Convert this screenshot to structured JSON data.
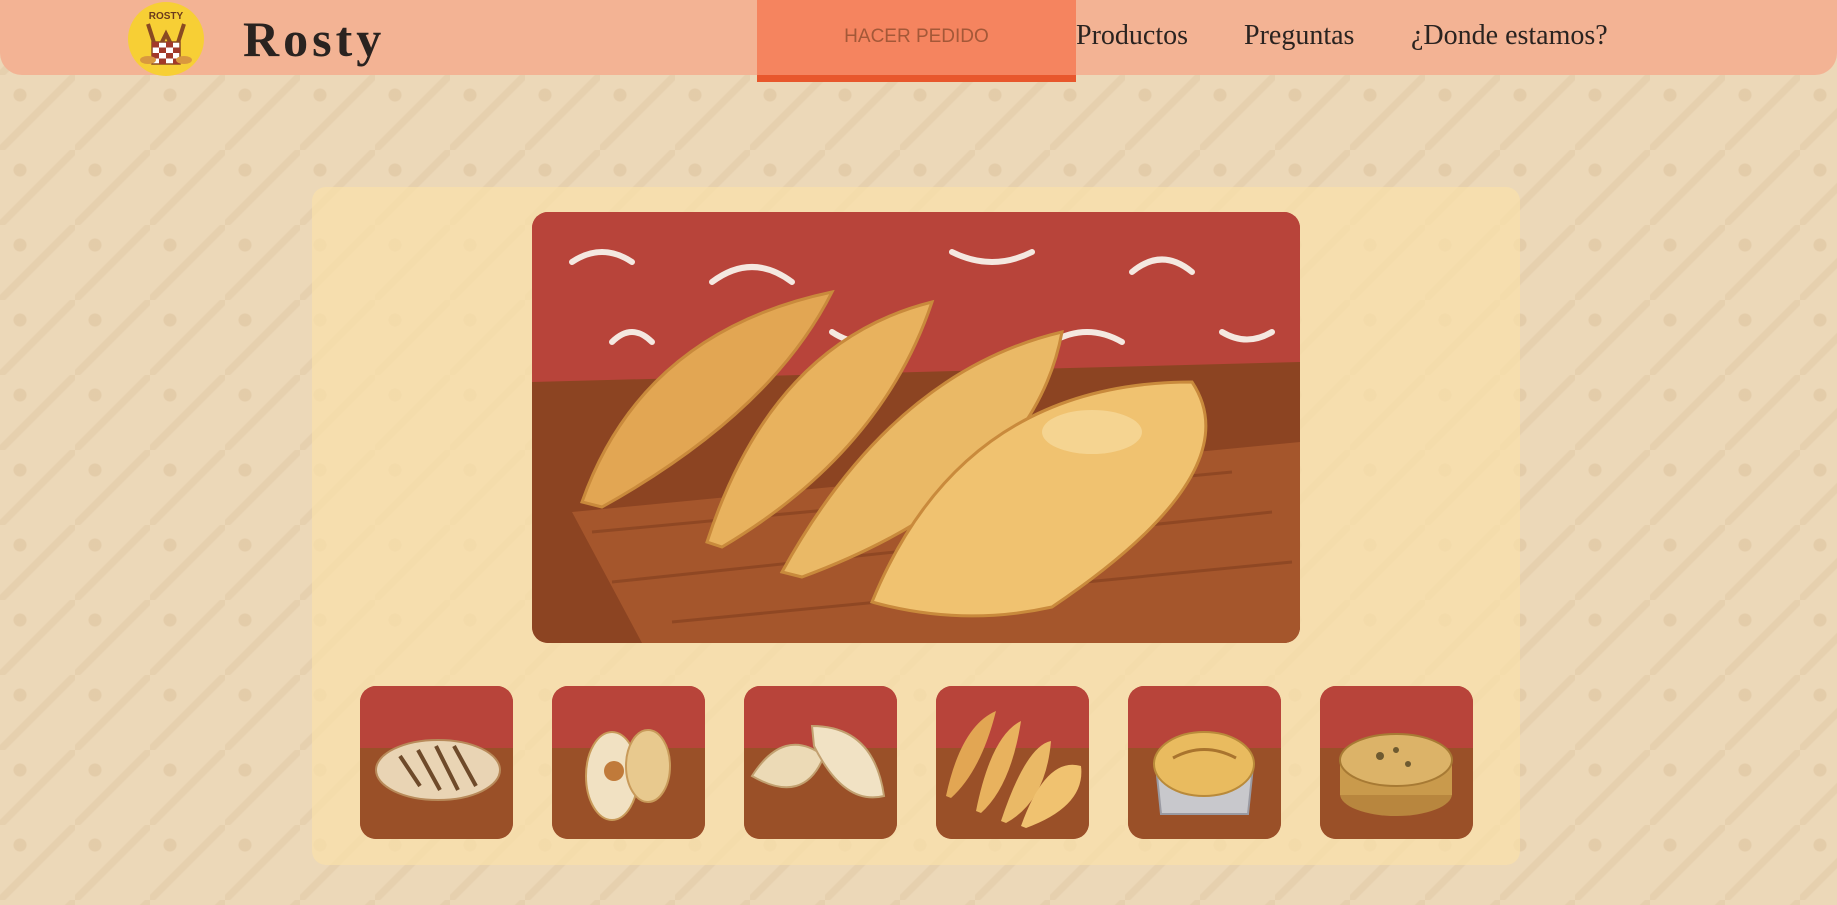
{
  "header": {
    "logo_text": "ROSTY",
    "brand": "Rosty",
    "order_button": "HACER PEDIDO",
    "nav": [
      "Productos",
      "Preguntas",
      "¿Donde estamos?"
    ]
  },
  "gallery": {
    "main_image": "empanadas-fritas-photo",
    "thumbnails": [
      "sandwich-grilled-photo",
      "baked-rolls-photo",
      "empanadas-horno-photo",
      "empanadas-fritas-photo",
      "tarta-tin-photo",
      "tarta-round-photo"
    ]
  },
  "colors": {
    "header_bg": "#f3b394",
    "order_button_bg": "#f5845f",
    "order_button_border": "#e8572c",
    "page_bg": "#ecd8b8",
    "panel_bg": "#f9e0aa"
  }
}
